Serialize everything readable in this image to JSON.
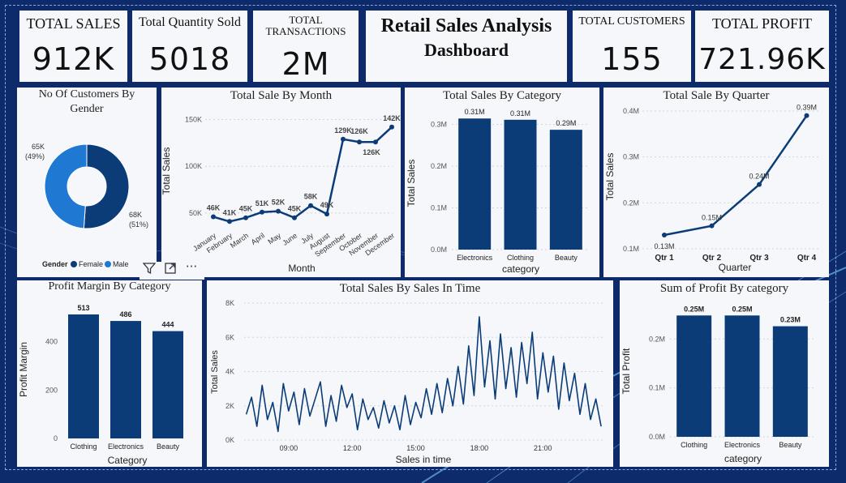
{
  "kpis": {
    "total_sales": {
      "label": "TOTAL SALES",
      "value": "912K"
    },
    "total_quantity": {
      "label": "Total Quantity Sold",
      "value": "5018"
    },
    "total_transactions": {
      "label_line1": "TOTAL",
      "label_line2": "TRANSACTIONS",
      "value": "2M"
    },
    "dashboard_title": {
      "line1": "Retail Sales Analysis",
      "line2": "Dashboard"
    },
    "total_customers": {
      "label": "TOTAL CUSTOMERS",
      "value": "155"
    },
    "total_profit": {
      "label": "TOTAL PROFIT",
      "value": "721.96K"
    }
  },
  "toolbar": {
    "filter_icon": "filter-icon",
    "focus_icon": "focus-mode-icon",
    "more_icon": "more-options-icon"
  },
  "colors": {
    "background": "#0d2a6b",
    "dark_blue": "#0b3c78",
    "light_blue": "#1f78d1",
    "card": "#f5f7fa"
  },
  "chart_data": [
    {
      "id": "gender",
      "type": "pie",
      "title_line1": "No Of Customers By",
      "title_line2": "Gender",
      "legend_title": "Gender",
      "slices": [
        {
          "name": "Female",
          "value": 68,
          "label": "68K",
          "pct": "(51%)",
          "color": "#0b3c78"
        },
        {
          "name": "Male",
          "value": 65,
          "label": "65K",
          "pct": "(49%)",
          "color": "#1f78d1"
        }
      ]
    },
    {
      "id": "month",
      "type": "line",
      "title": "Total Sale By Month",
      "xlabel": "Month",
      "ylabel": "Total Sales",
      "categories": [
        "January",
        "February",
        "March",
        "April",
        "May",
        "June",
        "July",
        "August",
        "September",
        "October",
        "November",
        "December"
      ],
      "values": [
        46,
        41,
        45,
        51,
        52,
        45,
        58,
        49,
        129,
        126,
        126,
        142
      ],
      "labels": [
        "46K",
        "41K",
        "45K",
        "51K",
        "52K",
        "45K",
        "58K",
        "49K",
        "129K",
        "126K",
        "126K",
        "142K"
      ],
      "yticks": [
        "50K",
        "100K",
        "150K"
      ],
      "ytick_values": [
        50,
        100,
        150
      ],
      "ylim": [
        30,
        160
      ]
    },
    {
      "id": "category",
      "type": "bar",
      "title": "Total Sales By Category",
      "xlabel": "category",
      "ylabel": "Total Sales",
      "categories": [
        "Electronics",
        "Clothing",
        "Beauty"
      ],
      "values": [
        0.314,
        0.311,
        0.287
      ],
      "labels": [
        "0.31M",
        "0.31M",
        "0.29M"
      ],
      "yticks": [
        "0.0M",
        "0.1M",
        "0.2M",
        "0.3M"
      ],
      "ytick_values": [
        0,
        0.1,
        0.2,
        0.3
      ],
      "ylim": [
        0,
        0.33
      ]
    },
    {
      "id": "quarter",
      "type": "line",
      "title": "Total Sale By Quarter",
      "xlabel": "Quarter",
      "ylabel": "Total Sales",
      "categories": [
        "Qtr 1",
        "Qtr 2",
        "Qtr 3",
        "Qtr 4"
      ],
      "values": [
        0.13,
        0.15,
        0.24,
        0.39
      ],
      "labels": [
        "0.13M",
        "0.15M",
        "0.24M",
        "0.39M"
      ],
      "yticks": [
        "0.1M",
        "0.2M",
        "0.3M",
        "0.4M"
      ],
      "ytick_values": [
        0.1,
        0.2,
        0.3,
        0.4
      ],
      "ylim": [
        0.1,
        0.4
      ]
    },
    {
      "id": "margin",
      "type": "bar",
      "title": "Profit Margin By Category",
      "xlabel": "Category",
      "ylabel": "Profit Margin",
      "categories": [
        "Clothing",
        "Electronics",
        "Beauty"
      ],
      "values": [
        513,
        486,
        444
      ],
      "labels": [
        "513",
        "486",
        "444"
      ],
      "yticks": [
        "0",
        "200",
        "400"
      ],
      "ytick_values": [
        0,
        200,
        400
      ],
      "ylim": [
        0,
        560
      ]
    },
    {
      "id": "time",
      "type": "line",
      "title": "Total Sales By Sales In Time",
      "xlabel": "Sales in time",
      "ylabel": "Total Sales",
      "xticks": [
        "09:00",
        "12:00",
        "15:00",
        "18:00",
        "21:00"
      ],
      "xtick_values": [
        9,
        12,
        15,
        18,
        21
      ],
      "xlim": [
        6.9,
        23.9
      ],
      "yticks": [
        "0K",
        "2K",
        "4K",
        "6K",
        "8K"
      ],
      "ytick_values": [
        0,
        2000,
        4000,
        6000,
        8000
      ],
      "ylim": [
        0,
        8000
      ],
      "x": [
        7.0,
        7.25,
        7.5,
        7.75,
        8.0,
        8.25,
        8.5,
        8.75,
        9.0,
        9.25,
        9.5,
        9.75,
        10.0,
        10.25,
        10.5,
        10.75,
        11.0,
        11.25,
        11.5,
        11.75,
        12.0,
        12.25,
        12.5,
        12.75,
        13.0,
        13.25,
        13.5,
        13.75,
        14.0,
        14.25,
        14.5,
        14.75,
        15.0,
        15.25,
        15.5,
        15.75,
        16.0,
        16.25,
        16.5,
        16.75,
        17.0,
        17.25,
        17.5,
        17.75,
        18.0,
        18.25,
        18.5,
        18.75,
        19.0,
        19.25,
        19.5,
        19.75,
        20.0,
        20.25,
        20.5,
        20.75,
        21.0,
        21.25,
        21.5,
        21.75,
        22.0,
        22.25,
        22.5,
        22.75,
        23.0,
        23.25,
        23.5,
        23.75
      ],
      "values": [
        1500,
        2500,
        800,
        3200,
        1200,
        2200,
        500,
        3300,
        1700,
        2800,
        900,
        3000,
        1400,
        2400,
        3400,
        800,
        2600,
        1100,
        3200,
        1900,
        2700,
        600,
        2400,
        1200,
        1900,
        700,
        2300,
        1000,
        2000,
        600,
        2600,
        900,
        2200,
        1300,
        3000,
        1500,
        3300,
        1600,
        3600,
        2000,
        4300,
        2100,
        5500,
        2600,
        7200,
        3100,
        5800,
        2400,
        6200,
        3000,
        5400,
        2500,
        5700,
        3300,
        6300,
        2400,
        5100,
        2800,
        4900,
        1800,
        4500,
        2300,
        3900,
        1500,
        3300,
        1200,
        2400,
        800
      ]
    },
    {
      "id": "profit",
      "type": "bar",
      "title": "Sum of Profit By category",
      "xlabel": "category",
      "ylabel": "Total Profit",
      "categories": [
        "Clothing",
        "Electronics",
        "Beauty"
      ],
      "values": [
        0.248,
        0.248,
        0.226
      ],
      "labels": [
        "0.25M",
        "0.25M",
        "0.23M"
      ],
      "yticks": [
        "0.0M",
        "0.1M",
        "0.2M"
      ],
      "ytick_values": [
        0,
        0.1,
        0.2
      ],
      "ylim": [
        0,
        0.27
      ]
    }
  ]
}
